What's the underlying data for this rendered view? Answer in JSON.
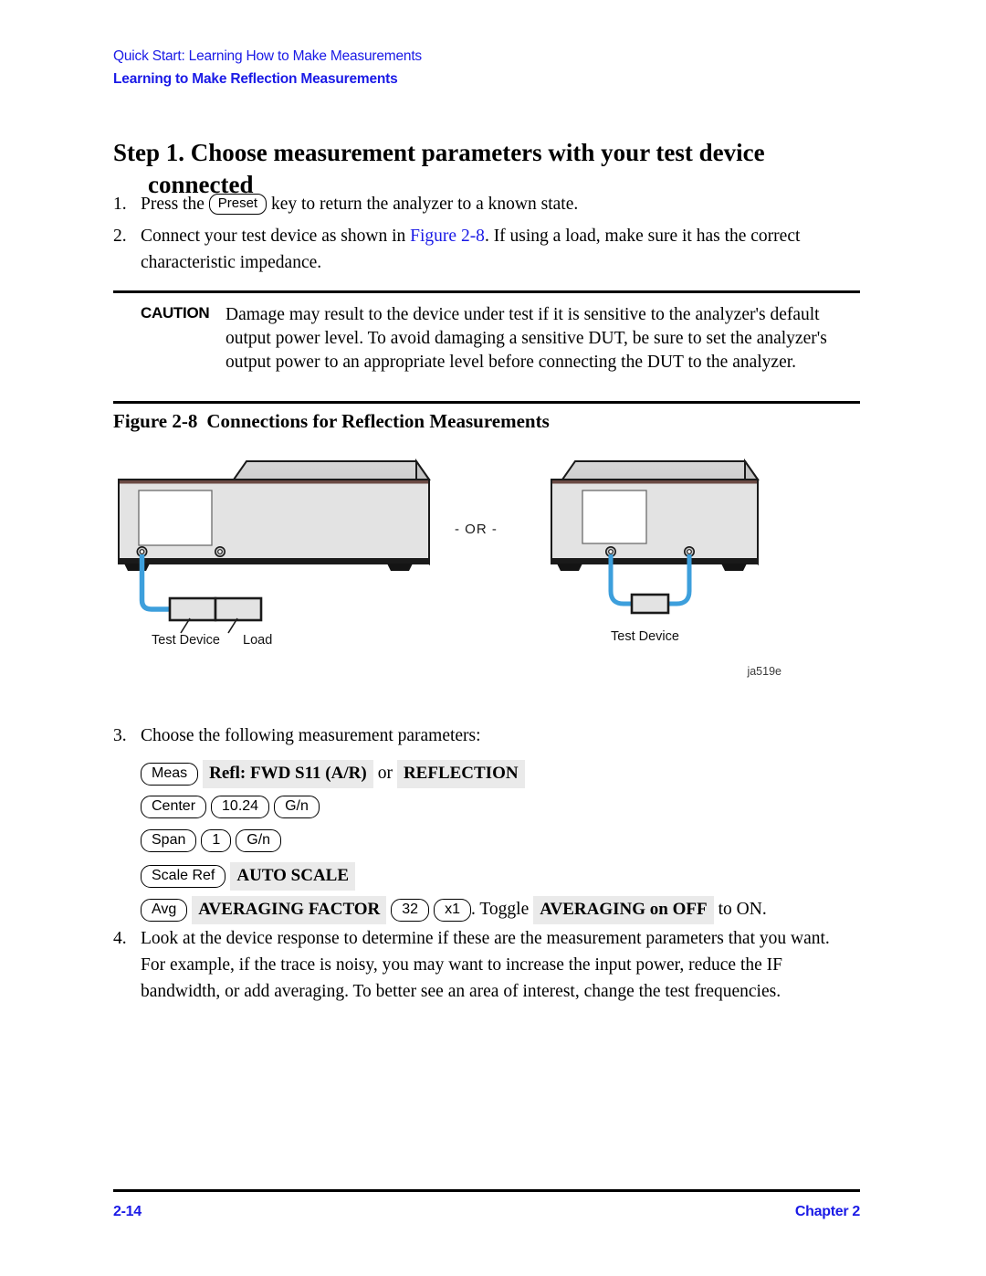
{
  "header": {
    "running_head": "Quick Start: Learning How to Make Measurements",
    "section_title": "Learning to Make Reflection Measurements",
    "color": "#1a1ae6"
  },
  "heading": {
    "line1": "Step 1. Choose measurement parameters with your test device",
    "line2": "connected"
  },
  "steps": {
    "item1": {
      "number": "1.",
      "text_before": "Press the",
      "key": "Preset",
      "text_after": "key to return the analyzer to a known state."
    },
    "item2": {
      "number": "2.",
      "text_before": "Connect your test device as shown in",
      "link": "Figure 2-8",
      "text_after": ". If using a load, make sure it has the correct characteristic impedance."
    },
    "item3": {
      "number": "3.",
      "text": "Choose the following measurement parameters:"
    },
    "item4": {
      "number": "4.",
      "text": "Look at the device response to determine if these are the measurement parameters that you want. For example, if the trace is noisy, you may want to increase the input power, reduce the IF bandwidth, or add averaging. To better see an area of interest, change the test frequencies."
    }
  },
  "caution": {
    "label": "CAUTION",
    "text": "Damage may result to the device under test if it is sensitive to the analyzer's default output power level. To avoid damaging a sensitive DUT, be sure to set the analyzer's output power to an appropriate level before connecting the DUT to the analyzer."
  },
  "figure": {
    "caption_number": "Figure 2-8",
    "caption_title": "Connections for Reflection Measurements",
    "or_separator": "- OR -",
    "figure_id": "ja519e",
    "left_diagram": {
      "labels": [
        "Test Device",
        "Load"
      ]
    },
    "right_diagram": {
      "labels": [
        "Test Device"
      ]
    },
    "cable_color": "#3d9fdc",
    "chassis_color": "#e3e3e3",
    "trim_color": "#6b4a44"
  },
  "key_sequences": [
    {
      "id": "meas",
      "parts": [
        {
          "type": "hardkey",
          "label": "Meas"
        },
        {
          "type": "softkey",
          "label": "Refl: FWD S11 (A/R)"
        },
        {
          "type": "text",
          "label": "or"
        },
        {
          "type": "softkey",
          "label": "REFLECTION"
        }
      ]
    },
    {
      "id": "center",
      "parts": [
        {
          "type": "hardkey",
          "label": "Center"
        },
        {
          "type": "hardkey",
          "label": "10.24"
        },
        {
          "type": "hardkey",
          "label": "G/n"
        }
      ]
    },
    {
      "id": "span",
      "parts": [
        {
          "type": "hardkey",
          "label": "Span"
        },
        {
          "type": "hardkey",
          "label": "1"
        },
        {
          "type": "hardkey",
          "label": "G/n"
        }
      ]
    },
    {
      "id": "scale",
      "parts": [
        {
          "type": "hardkey",
          "label": "Scale Ref"
        },
        {
          "type": "softkey",
          "label": "AUTO SCALE"
        }
      ]
    },
    {
      "id": "avg",
      "parts": [
        {
          "type": "hardkey",
          "label": "Avg"
        },
        {
          "type": "softkey",
          "label": "AVERAGING FACTOR"
        },
        {
          "type": "hardkey",
          "label": "32"
        },
        {
          "type": "hardkey",
          "label": "x1"
        },
        {
          "type": "text",
          "label": ". Toggle"
        },
        {
          "type": "softkey",
          "label": "AVERAGING on OFF"
        },
        {
          "type": "text",
          "label": "to ON."
        }
      ]
    }
  ],
  "keys": {
    "preset": "Preset",
    "meas": "Meas",
    "center": "Center",
    "center_value": "10.24",
    "center_unit": "G/n",
    "span": "Span",
    "span_value": "1",
    "span_unit": "G/n",
    "scale_ref": "Scale Ref",
    "avg": "Avg",
    "avg_value": "32",
    "avg_unit": "x1"
  },
  "softkeys": {
    "refl_fwd": "Refl: FWD S11 (A/R)",
    "or_word": "or",
    "reflection": "REFLECTION",
    "auto_scale": "AUTO SCALE",
    "averaging_factor": "AVERAGING FACTOR",
    "toggle_text": ". Toggle",
    "averaging_on_off": "AVERAGING on OFF",
    "to_on": "to ON."
  },
  "footer": {
    "page_number": "2-14",
    "chapter": "Chapter 2",
    "color": "#1a1ae6"
  }
}
